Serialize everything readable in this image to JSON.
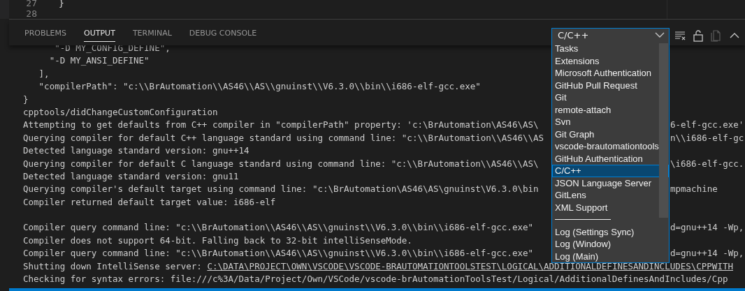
{
  "editor": {
    "lines": [
      {
        "number": "27",
        "code": "}"
      },
      {
        "number": "28"
      }
    ]
  },
  "panel": {
    "tabs": [
      {
        "label": "PROBLEMS",
        "selected": false
      },
      {
        "label": "OUTPUT",
        "selected": true
      },
      {
        "label": "TERMINAL",
        "selected": false
      },
      {
        "label": "DEBUG CONSOLE",
        "selected": false
      }
    ],
    "channel_select": {
      "value": "C/C++",
      "expanded": true,
      "options": [
        {
          "kind": "item",
          "label": "Tasks",
          "selected": false
        },
        {
          "kind": "item",
          "label": "Extensions",
          "selected": false
        },
        {
          "kind": "item",
          "label": "Microsoft Authentication",
          "selected": false
        },
        {
          "kind": "item",
          "label": "GitHub Pull Request",
          "selected": false
        },
        {
          "kind": "item",
          "label": "Git",
          "selected": false
        },
        {
          "kind": "item",
          "label": "remote-attach",
          "selected": false
        },
        {
          "kind": "item",
          "label": "Svn",
          "selected": false
        },
        {
          "kind": "item",
          "label": "Git Graph",
          "selected": false
        },
        {
          "kind": "item",
          "label": "vscode-brautomationtools",
          "selected": false
        },
        {
          "kind": "item",
          "label": "GitHub Authentication",
          "selected": false
        },
        {
          "kind": "item",
          "label": "C/C++",
          "selected": true
        },
        {
          "kind": "item",
          "label": "JSON Language Server",
          "selected": false
        },
        {
          "kind": "item",
          "label": "GitLens",
          "selected": false
        },
        {
          "kind": "item",
          "label": "XML Support",
          "selected": false
        },
        {
          "kind": "separator"
        },
        {
          "kind": "item",
          "label": "Log (Settings Sync)",
          "selected": false
        },
        {
          "kind": "item",
          "label": "Log (Window)",
          "selected": false
        },
        {
          "kind": "item",
          "label": "Log (Main)",
          "selected": false
        }
      ]
    },
    "actions": [
      {
        "kind": "clear",
        "disabled": false
      },
      {
        "kind": "lock",
        "disabled": false
      },
      {
        "kind": "open",
        "disabled": true
      },
      {
        "kind": "maximize",
        "disabled": false
      }
    ],
    "output": [
      {
        "text": "      \"-D MY_CONFIG_DEFINE\","
      },
      {
        "text": "     \"-D MY_ANSI_DEFINE\""
      },
      {
        "text": "   ],"
      },
      {
        "text": "   \"compilerPath\": \"c:\\\\BrAutomation\\\\AS46\\\\AS\\\\gnuinst\\\\V6.3.0\\\\bin\\\\i686-elf-gcc.exe\""
      },
      {
        "text": "}"
      },
      {
        "text": "cpptools/didChangeCustomConfiguration"
      },
      {
        "text": "Attempting to get defaults from C++ compiler in \"compilerPath\" property: 'c:\\BrAutomation\\AS46\\AS\\",
        "tail": "6-elf-gcc.exe'"
      },
      {
        "text": "Querying compiler for default C++ language standard using command line: \"c:\\\\BrAutomation\\\\AS46\\\\AS",
        "tail": "n\\\\i686-elf-gc"
      },
      {
        "text": "Detected language standard version: gnu++14"
      },
      {
        "text": "Querying compiler for default C language standard using command line: \"c:\\\\BrAutomation\\\\AS46\\\\AS\\",
        "tail": "\\i686-elf-gcc."
      },
      {
        "text": "Detected language standard version: gnu11"
      },
      {
        "text": "Querying compiler's default target using command line: \"c:\\BrAutomation\\AS46\\AS\\gnuinst\\V6.3.0\\bin",
        "tail": "mpmachine"
      },
      {
        "text": "Compiler returned default target value: i686-elf"
      },
      {
        "kind": "blank"
      },
      {
        "text": "Compiler query command line: \"c:\\\\BrAutomation\\\\AS46\\\\AS\\\\gnuinst\\\\V6.3.0\\\\bin\\\\i686-elf-gcc.exe\"",
        "tail": "d=gnu++14 -Wp,"
      },
      {
        "text": "Compiler does not support 64-bit. Falling back to 32-bit intelliSenseMode."
      },
      {
        "text": "Compiler query command line: \"c:\\\\BrAutomation\\\\AS46\\\\AS\\\\gnuinst\\\\V6.3.0\\\\bin\\\\i686-elf-gcc.exe\"",
        "tail": "d=gnu++14 -Wp,"
      },
      {
        "text": "Shutting down IntelliSense server: ",
        "link": "C:\\DATA\\PROJECT\\OWN\\VSCODE\\VSCODE-BRAUTOMATIONTOOLSTEST\\LOGICAL\\ADDITIONALDEFINESANDINCLUDES\\CPPWITH"
      },
      {
        "text": "Checking for syntax errors: file:///c%3A/Data/Project/Own/VSCode/vscode-brAutomationToolsTest/Logical/AdditionalDefinesAndIncludes/Cpp"
      }
    ]
  }
}
